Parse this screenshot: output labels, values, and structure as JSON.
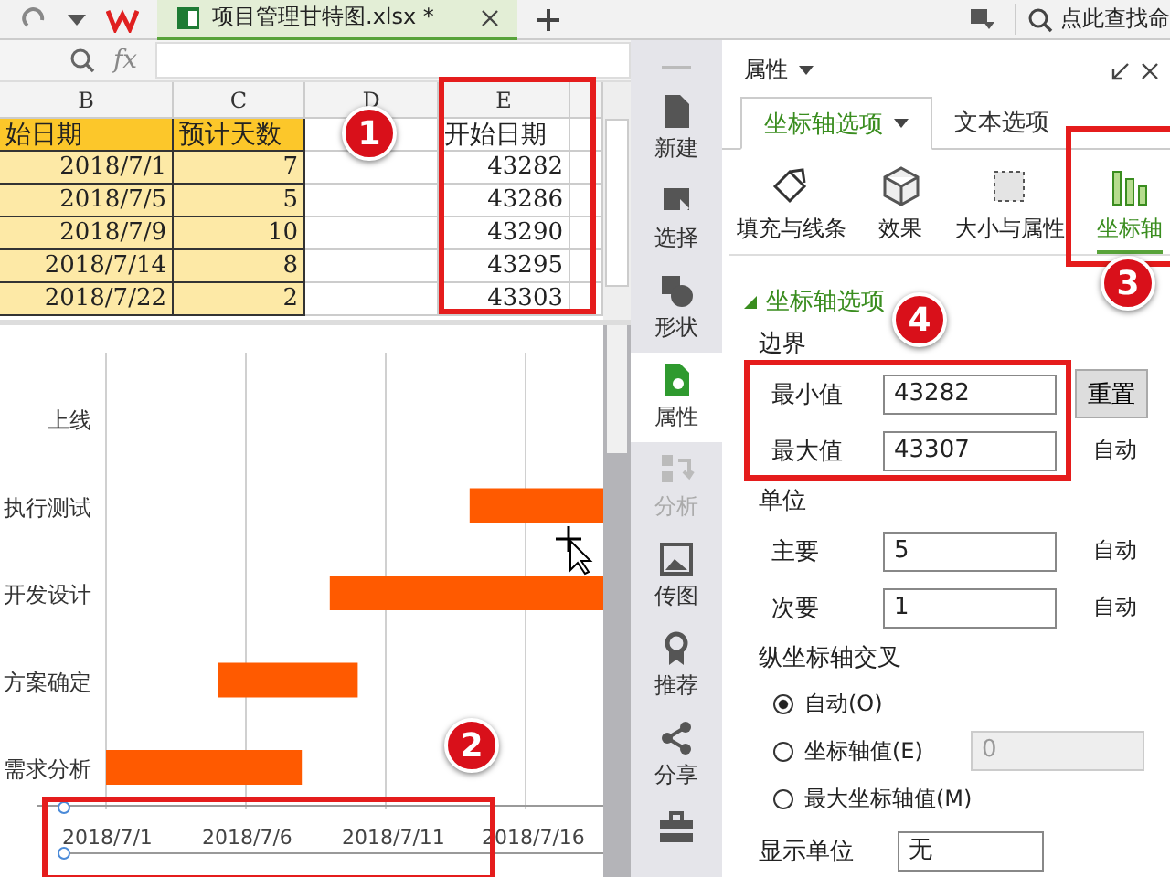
{
  "title_bar": {
    "file_tab": {
      "label": "项目管理甘特图.xlsx *",
      "selected": true
    },
    "search": {
      "placeholder": "点此查找命"
    }
  },
  "formula_bar": {
    "fx": "fx"
  },
  "sheet": {
    "columns": [
      "B",
      "C",
      "D",
      "E"
    ],
    "rows": [
      {
        "cells": [
          "始日期",
          "预计天数",
          "",
          "开始日期"
        ],
        "kind": "header"
      },
      {
        "cells": [
          "2018/7/1",
          "7",
          "",
          "43282"
        ],
        "kind": "data"
      },
      {
        "cells": [
          "2018/7/5",
          "5",
          "",
          "43286"
        ],
        "kind": "data"
      },
      {
        "cells": [
          "2018/7/9",
          "10",
          "",
          "43290"
        ],
        "kind": "data"
      },
      {
        "cells": [
          "2018/7/14",
          "8",
          "",
          "43295"
        ],
        "kind": "data"
      },
      {
        "cells": [
          "2018/7/22",
          "2",
          "",
          "43303"
        ],
        "kind": "data"
      }
    ]
  },
  "chart": {
    "categories": [
      "上线",
      "执行测试",
      "开发设计",
      "方案确定",
      "需求分析"
    ],
    "axis_labels": [
      "2018/7/1",
      "2018/7/6",
      "2018/7/11",
      "2018/7/16"
    ]
  },
  "sidebar": {
    "items": [
      {
        "label": "新建",
        "selected": false,
        "disabled": false
      },
      {
        "label": "选择",
        "selected": false,
        "disabled": false
      },
      {
        "label": "形状",
        "selected": false,
        "disabled": false
      },
      {
        "label": "属性",
        "selected": true,
        "disabled": false
      },
      {
        "label": "分析",
        "selected": false,
        "disabled": true
      },
      {
        "label": "传图",
        "selected": false,
        "disabled": false
      },
      {
        "label": "推荐",
        "selected": false,
        "disabled": false
      },
      {
        "label": "分享",
        "selected": false,
        "disabled": false
      },
      {
        "selected": false,
        "disabled": false
      }
    ]
  },
  "panel": {
    "title": "属性",
    "tabs": [
      {
        "label": "坐标轴选项",
        "selected": true
      },
      {
        "label": "文本选项",
        "selected": false
      }
    ],
    "icon_tabs": [
      {
        "label": "填充与线条",
        "selected": false
      },
      {
        "label": "效果",
        "selected": false
      },
      {
        "label": "大小与属性",
        "selected": false
      },
      {
        "label": "坐标轴",
        "selected": true
      }
    ],
    "section": {
      "title": "坐标轴选项",
      "expanded": true
    },
    "bounds": {
      "label": "边界",
      "min": {
        "label": "最小值",
        "value": "43282",
        "button": "重置"
      },
      "max": {
        "label": "最大值",
        "value": "43307",
        "auto": "自动"
      }
    },
    "units": {
      "label": "单位",
      "major": {
        "label": "主要",
        "value": "5",
        "auto": "自动"
      },
      "minor": {
        "label": "次要",
        "value": "1",
        "auto": "自动"
      }
    },
    "cross": {
      "label": "纵坐标轴交叉",
      "options": [
        {
          "label": "自动(O)",
          "selected": true
        },
        {
          "label": "坐标轴值(E)",
          "selected": false,
          "field": "0"
        },
        {
          "label": "最大坐标轴值(M)",
          "selected": false
        }
      ]
    },
    "display_unit": {
      "label": "显示单位",
      "value": "无"
    }
  },
  "callouts": [
    {
      "number": "1"
    },
    {
      "number": "2"
    },
    {
      "number": "3"
    },
    {
      "number": "4"
    }
  ]
}
